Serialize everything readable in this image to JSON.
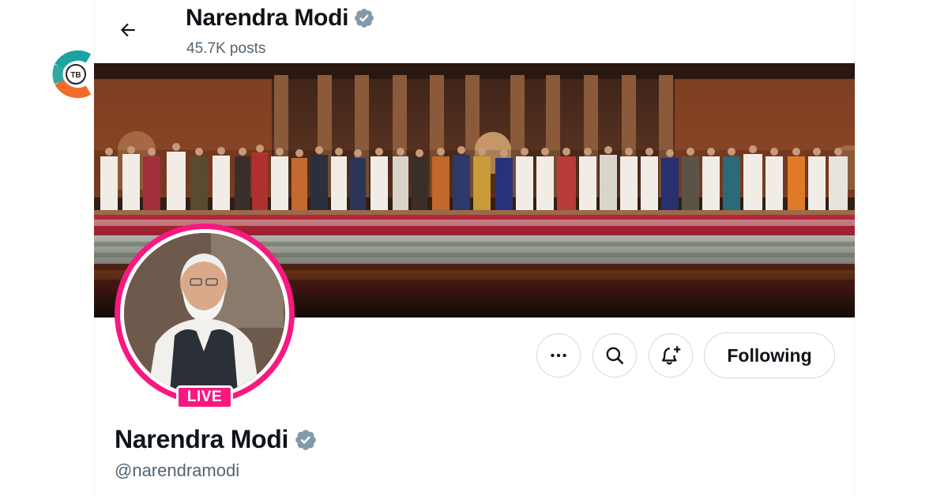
{
  "header": {
    "back_icon": "arrow-left-icon",
    "name": "Narendra Modi",
    "posts_count": "45.7K posts",
    "verified_icon": "verified-badge-icon"
  },
  "watermark": {
    "logo_text": "TB"
  },
  "profile": {
    "live_label": "LIVE",
    "name": "Narendra Modi",
    "handle": "@narendramodi"
  },
  "actions": {
    "more_icon": "more-dots-icon",
    "search_icon": "search-icon",
    "notify_icon": "bell-plus-icon",
    "following_label": "Following"
  },
  "colors": {
    "live_ring": "#f91880",
    "verified": "#829aab",
    "secondary_text": "#536471",
    "logo_teal": "#1aa3a0",
    "logo_orange": "#f26b2a"
  }
}
